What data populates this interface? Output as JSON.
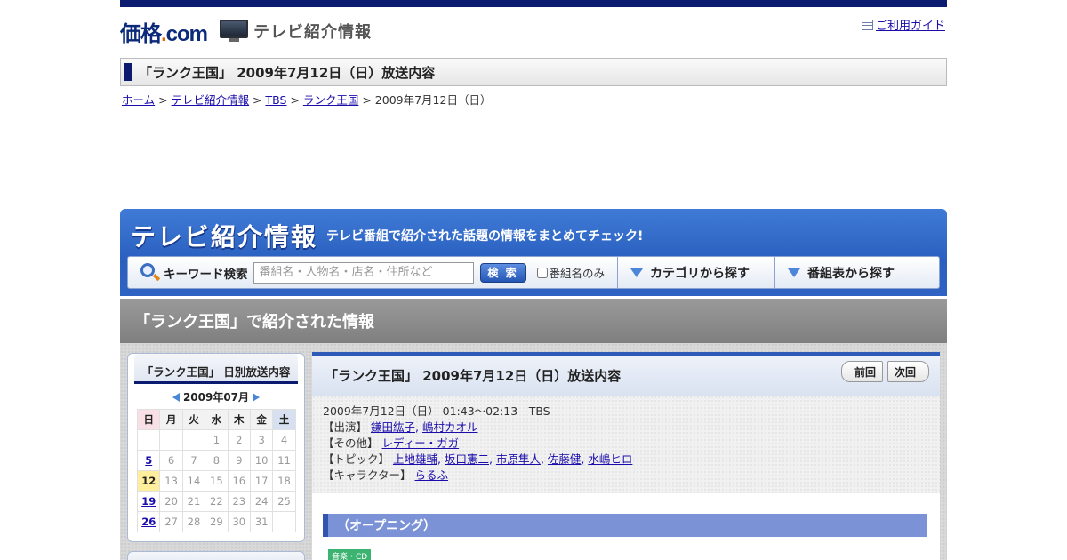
{
  "header": {
    "logo_main": "価格",
    "logo_dot": ".",
    "logo_com": "com",
    "logo_sub": "テレビ紹介情報",
    "guide_link": "ご利用ガイド"
  },
  "page_title": "「ランク王国」 2009年7月12日（日）放送内容",
  "breadcrumb": {
    "items": [
      "ホーム",
      "テレビ紹介情報",
      "TBS",
      "ランク王国"
    ],
    "current": "2009年7月12日（日）",
    "separator": " > "
  },
  "hero": {
    "logo": "テレビ紹介情報",
    "catch": "テレビ番組で紹介された話題の情報をまとめてチェック!",
    "search_label": "キーワード検索",
    "search_placeholder": "番組名・人物名・店名・住所など",
    "search_button": "検 索",
    "checkbox_label": "番組名のみ",
    "tab_category": "カテゴリから探す",
    "tab_program": "番組表から探す"
  },
  "section_title": "「ランク王国」で紹介された情報",
  "calendar": {
    "title": "「ランク王国」 日別放送内容",
    "month": "2009年07月",
    "weekdays": [
      "日",
      "月",
      "火",
      "水",
      "木",
      "金",
      "土"
    ],
    "weeks": [
      [
        "",
        "",
        "",
        "1",
        "2",
        "3",
        "4"
      ],
      [
        "5",
        "6",
        "7",
        "8",
        "9",
        "10",
        "11"
      ],
      [
        "12",
        "13",
        "14",
        "15",
        "16",
        "17",
        "18"
      ],
      [
        "19",
        "20",
        "21",
        "22",
        "23",
        "24",
        "25"
      ],
      [
        "26",
        "27",
        "28",
        "29",
        "30",
        "31",
        ""
      ]
    ],
    "linked_days": [
      "5",
      "19",
      "26"
    ],
    "selected_day": "12"
  },
  "main": {
    "title": "「ランク王国」 2009年7月12日（日）放送内容",
    "prev_button": "前回",
    "next_button": "次回",
    "broadcast": "2009年7月12日（日） 01:43～02:13　TBS",
    "cast_label": "【出演】",
    "cast": [
      "鎌田紘子",
      "嶋村カオル"
    ],
    "other_label": "【その他】",
    "other": [
      "レディー・ガガ"
    ],
    "topic_label": "【トピック】",
    "topics": [
      "上地雄輔",
      "坂口憲二",
      "市原隼人",
      "佐藤健",
      "水嶋ヒロ"
    ],
    "character_label": "【キャラクター】",
    "characters": [
      "らるふ"
    ],
    "list_sep": ", ",
    "segment_title": "（オープニング）",
    "badge": "音楽・CD"
  },
  "colors": {
    "navy": "#0b1b6f",
    "hero_blue": "#2a5fbf",
    "link": "#1a0dab",
    "segment_bar": "#7b93d6"
  }
}
